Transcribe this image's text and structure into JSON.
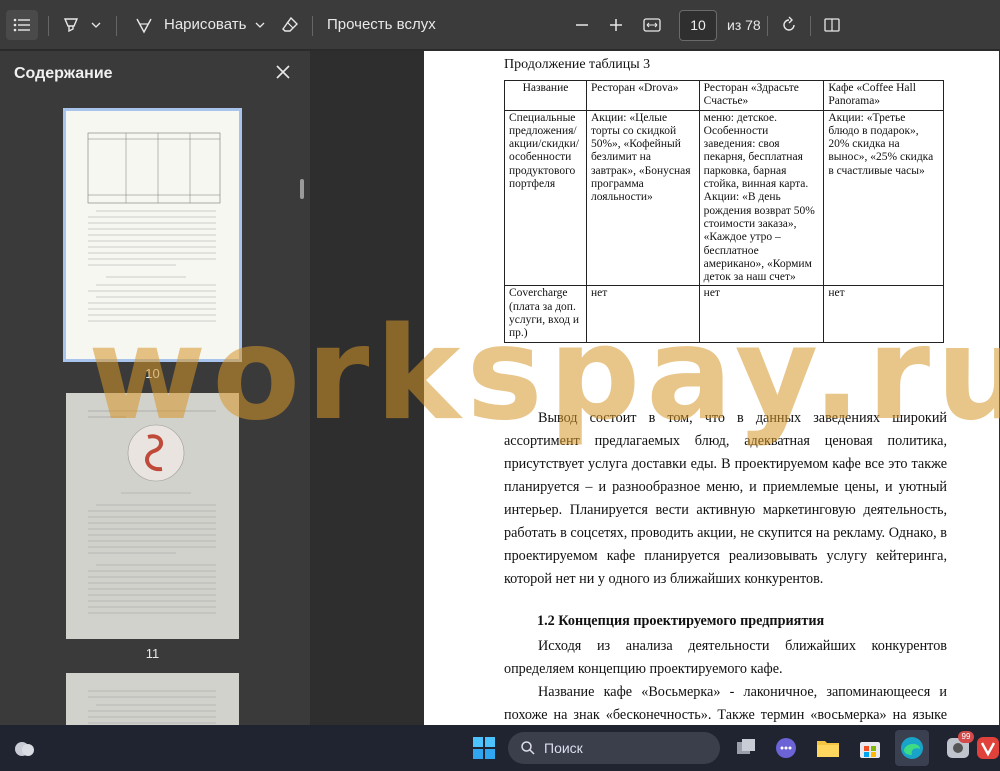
{
  "toolbar": {
    "draw_label": "Нарисовать",
    "read_aloud_label": "Прочесть вслух",
    "page_number": "10",
    "page_total": "из 78"
  },
  "sidebar": {
    "title": "Содержание",
    "thumb_numbers": [
      "10",
      "11"
    ]
  },
  "document": {
    "table_title": "Продолжение таблицы 3",
    "table": {
      "headers": [
        "Название",
        "Ресторан «Drova»",
        "Ресторан «Здрасьте Счастье»",
        "Кафе «Coffee Hall Panorama»"
      ],
      "rows": [
        [
          "Специальные предложения/ акции/скидки/ особенности продуктового портфеля",
          "Акции: «Целые торты со скидкой 50%», «Кофейный безлимит на завтрак», «Бонусная программа лояльности»",
          "меню: детское. Особенности заведения: своя пекарня, бесплатная парковка, барная стойка, винная карта. Акции: «В день рождения возврат 50% стоимости заказа», «Каждое утро – бесплатное американо», «Кормим деток за наш счет»",
          "Акции: «Третье блюдо в подарок», 20% скидка на вынос», «25% скидка в счастливые часы»"
        ],
        [
          "Covercharge (плата за доп. услуги, вход и пр.)",
          "нет",
          "нет",
          "нет"
        ]
      ]
    },
    "paragraph1": "Вывод состоит в том, что в данных заведениях широкий ассортимент предлагаемых блюд, адекватная ценовая политика, присутствует услуга доставки еды. В проектируемом кафе все это также планируется – и разнообразное меню, и приемлемые цены, и уютный интерьер. Планируется вести активную маркетинговую деятельность, работать в соцсетях, проводить акции, не скупится на рекламу. Однако, в проектируемом кафе планируется реализовывать услугу кейтеринга, которой нет ни у одного из ближайших конкурентов.",
    "heading": "1.2 Концепция проектируемого предприятия",
    "paragraph2": "Исходя из анализа деятельности ближайших конкурентов определяем концепцию проектируемого кафе.",
    "paragraph3": "Название кафе «Восьмерка» - лаконичное, запоминающееся и похоже на знак «бесконечность». Также термин «восьмерка» на языке официантов означает тщательно и постоянно следить за чистотой вверенных им столиков, постоянно и внимательно следить за пожеланиями гостей и неотступно"
  },
  "watermark": "workspay.ru",
  "taskbar": {
    "search_label": "Поиск",
    "badge_count": "99"
  },
  "colors": {
    "toolbar_bg": "#3b3b3b",
    "sidebar_bg": "#3a3a3a",
    "selected_thumb_outline": "#a9c4ec",
    "watermark": "#d69628"
  },
  "icons": [
    "table-of-contents-icon",
    "highlighter-icon",
    "chevron-down-icon",
    "pen-icon",
    "eraser-icon",
    "zoom-out-icon",
    "zoom-in-icon",
    "fit-width-icon",
    "rotate-icon",
    "two-page-icon",
    "close-icon",
    "weather-icon",
    "windows-start-icon",
    "search-icon",
    "task-view-icon",
    "chat-icon",
    "file-explorer-icon",
    "store-icon",
    "edge-icon",
    "app-icon",
    "vivaldi-icon"
  ]
}
